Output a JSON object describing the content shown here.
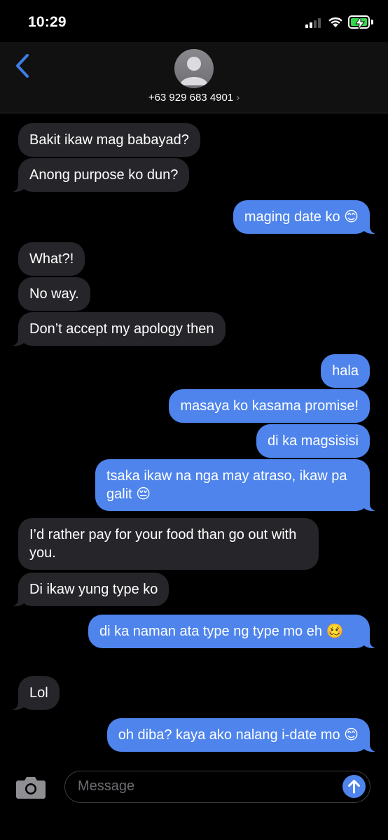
{
  "status": {
    "time": "10:29",
    "battery_color": "#32d74b"
  },
  "header": {
    "contact": "+63 929 683 4901",
    "chevron": "›"
  },
  "messages": [
    {
      "from": "them",
      "text": "Bakit ikaw mag babayad?"
    },
    {
      "from": "them",
      "text": "Anong purpose ko dun?"
    },
    {
      "from": "me",
      "text": "maging date ko 😊"
    },
    {
      "from": "them",
      "text": "What?!"
    },
    {
      "from": "them",
      "text": "No way."
    },
    {
      "from": "them",
      "text": "Don’t accept my apology then"
    },
    {
      "from": "me",
      "text": "hala"
    },
    {
      "from": "me",
      "text": "masaya ko kasama promise!"
    },
    {
      "from": "me",
      "text": "di ka magsisisi"
    },
    {
      "from": "me",
      "text": "tsaka ikaw na nga may atraso, ikaw pa galit 😔"
    },
    {
      "from": "them",
      "text": "I’d rather pay for your food than go out with you."
    },
    {
      "from": "them",
      "text": "Di ikaw yung type ko"
    },
    {
      "from": "me",
      "text": "di ka naman ata type ng type mo eh 🥴"
    },
    {
      "from": "them",
      "text": "Lol"
    },
    {
      "from": "me",
      "text": "oh diba? kaya ako nalang i-date mo 😊"
    }
  ],
  "compose": {
    "placeholder": "Message"
  },
  "colors": {
    "incoming_bubble": "#26252a",
    "outgoing_bubble": "#4e84ec",
    "accent": "#3d7fe6"
  },
  "icons": {
    "back": "chevron-left-icon",
    "camera": "camera-icon",
    "send": "arrow-up-icon",
    "avatar": "person-icon"
  }
}
